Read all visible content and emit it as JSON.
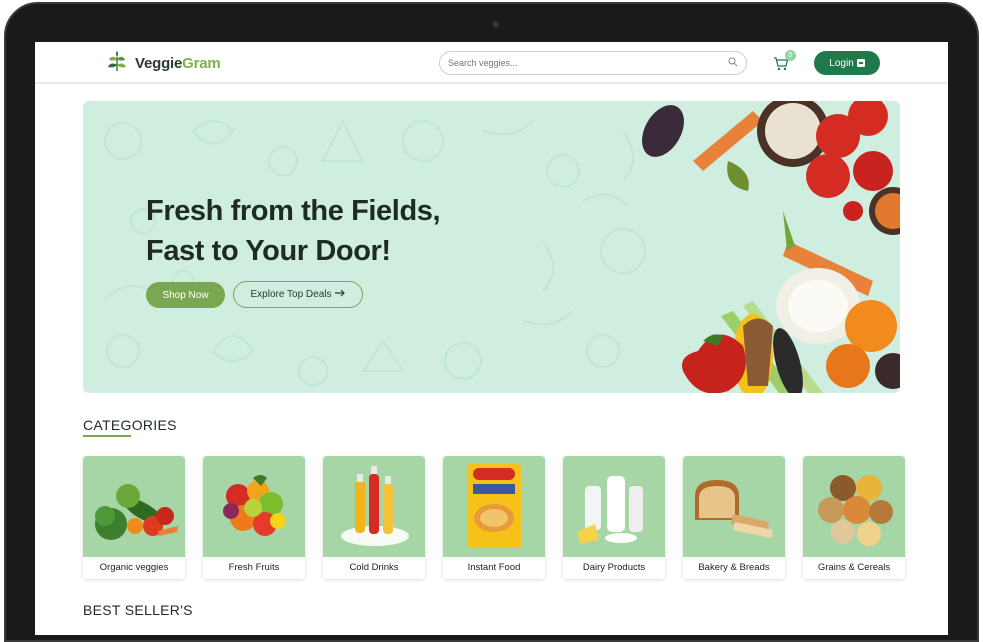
{
  "brand": {
    "name_part1": "Veggie",
    "name_part2": "Gram"
  },
  "search": {
    "placeholder": "Search veggies..."
  },
  "cart": {
    "count": "0"
  },
  "header": {
    "login_label": "Login"
  },
  "hero": {
    "title_line1": "Fresh from the Fields,",
    "title_line2": "Fast to Your Door!",
    "shop_label": "Shop Now",
    "deals_label": "Explore Top Deals"
  },
  "categories": {
    "title": "CATEGORIES",
    "items": [
      {
        "label": "Organic veggies",
        "icon": "vegetables-icon"
      },
      {
        "label": "Fresh Fruits",
        "icon": "fruits-icon"
      },
      {
        "label": "Cold Drinks",
        "icon": "drinks-icon"
      },
      {
        "label": "Instant Food",
        "icon": "noodles-icon"
      },
      {
        "label": "Dairy Products",
        "icon": "dairy-icon"
      },
      {
        "label": "Bakery & Breads",
        "icon": "bread-icon"
      },
      {
        "label": "Grains & Cereals",
        "icon": "grains-icon"
      }
    ]
  },
  "best_sellers": {
    "title": "BEST SELLER'S"
  },
  "colors": {
    "primary": "#1f7a4a",
    "accent": "#7aa851",
    "hero_bg": "#cfeee0",
    "card_bg": "#a6d6a6"
  }
}
